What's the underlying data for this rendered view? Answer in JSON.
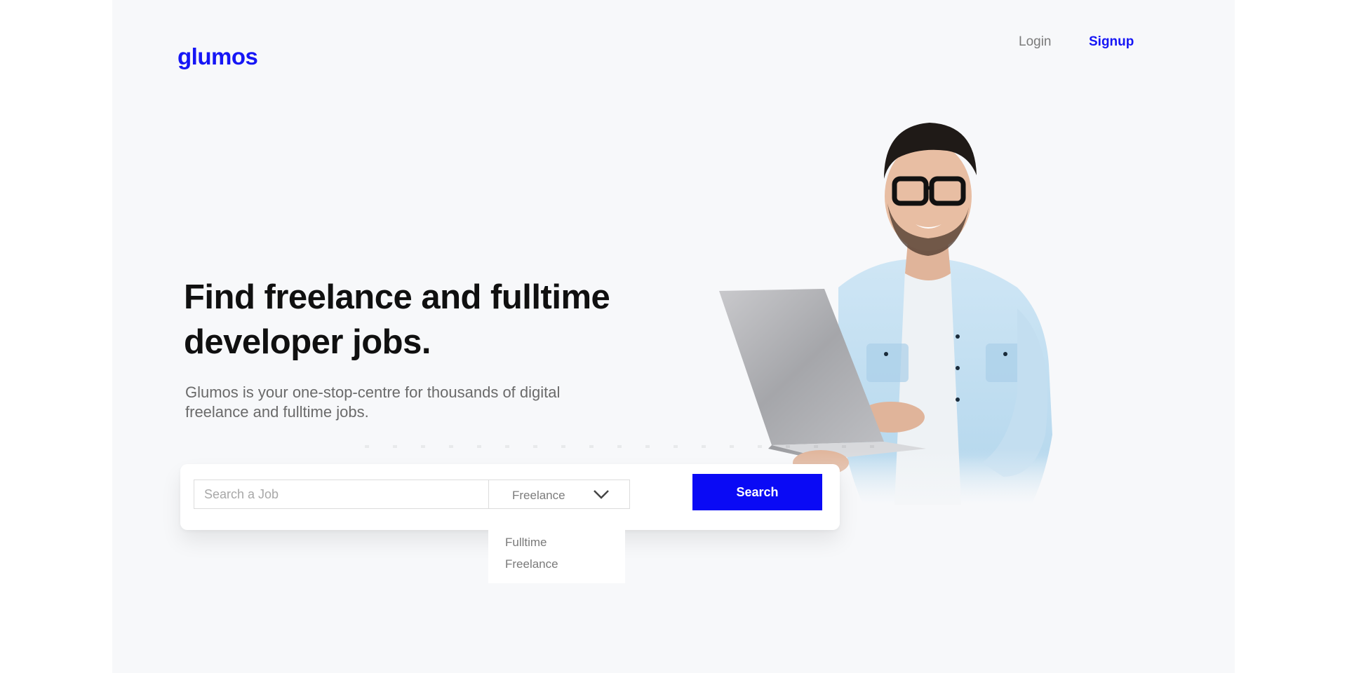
{
  "header": {
    "logo": "glumos",
    "login_label": "Login",
    "signup_label": "Signup"
  },
  "hero": {
    "headline_line1": "Find freelance and fulltime",
    "headline_line2": "developer jobs.",
    "subtext_line1": "Glumos is your one-stop-centre for thousands of digital",
    "subtext_line2": "freelance and fulltime jobs."
  },
  "search": {
    "placeholder": "Search a Job",
    "value": "",
    "type_selected": "Freelance",
    "button_label": "Search",
    "dropdown_options": [
      "Fulltime",
      "Freelance"
    ]
  },
  "colors": {
    "brand": "#1616f5",
    "button": "#0a0af5",
    "background": "#f7f8fa"
  },
  "icons": {
    "dropdown": "chevron-down-icon"
  }
}
